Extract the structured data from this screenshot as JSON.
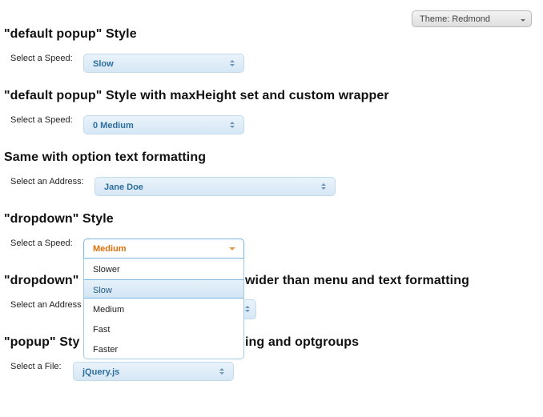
{
  "theme_switcher": {
    "label": "Theme: Redmond"
  },
  "sections": [
    {
      "heading": "\"default popup\" Style",
      "field_label": "Select a Speed:",
      "value": "Slow"
    },
    {
      "heading": "\"default popup\" Style with maxHeight set and custom wrapper",
      "field_label": "Select a Speed:",
      "value": "0 Medium"
    },
    {
      "heading": "Same with option text formatting",
      "field_label": "Select an Address:",
      "value": "Jane Doe"
    },
    {
      "heading": "\"dropdown\" Style",
      "field_label": "Select a Speed:",
      "value": "Medium"
    },
    {
      "heading_start": "\"dropdown\"",
      "heading_end": "wider than menu and text formatting",
      "field_label": "Select an Address"
    },
    {
      "heading_start": "\"popup\" Sty",
      "heading_end": "ing and optgroups",
      "field_label": "Select a File:",
      "value": "jQuery.js"
    }
  ],
  "dropdown_menu": {
    "options": [
      "Slower",
      "Slow",
      "Medium",
      "Fast",
      "Faster"
    ],
    "active_option": "Slow"
  },
  "colors": {
    "button_text": "#2e6e9e",
    "open_text": "#e17009",
    "button_border": "#c5dbec"
  }
}
